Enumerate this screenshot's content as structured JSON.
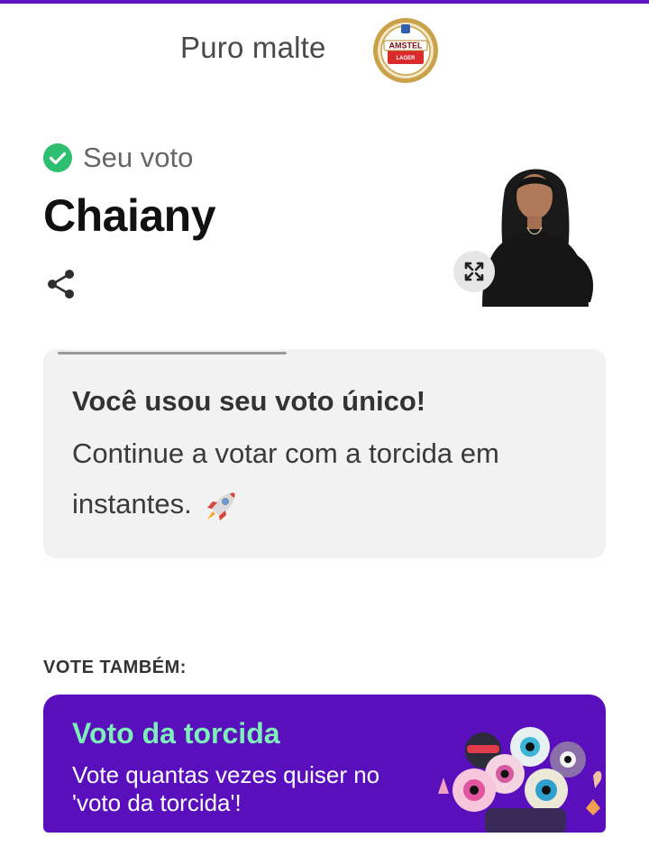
{
  "sponsor": {
    "text": "Puro malte",
    "logo_text_top": "AMSTEL",
    "logo_text_bottom": "LAGER"
  },
  "vote_result": {
    "label": "Seu voto",
    "candidate": "Chaiany"
  },
  "info_card": {
    "title": "Você usou seu voto único!",
    "body": "Continue a votar com a torcida em instantes."
  },
  "also_vote": {
    "label": "VOTE TAMBÉM:"
  },
  "promo": {
    "title": "Voto da torcida",
    "description": "Vote quantas vezes quiser no 'voto da torcida'!"
  },
  "icons": {
    "check": "check-circle-icon",
    "share": "share-icon",
    "expand": "expand-icon",
    "rocket": "rocket-icon"
  },
  "colors": {
    "brand_purple": "#5a0fbd",
    "accent_green": "#7df0b8",
    "check_green": "#2fbf71"
  }
}
